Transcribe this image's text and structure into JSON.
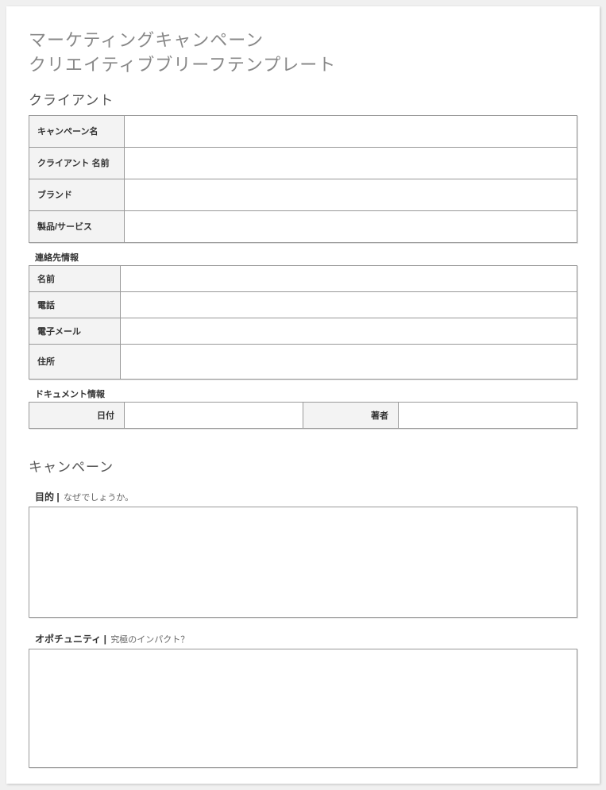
{
  "title1": "マーケティングキャンペーン",
  "title2": "クリエイティブブリーフテンプレート",
  "sections": {
    "client": {
      "heading": "クライアント",
      "rows": {
        "campaign_name": {
          "label": "キャンペーン名",
          "value": ""
        },
        "client_name": {
          "label": "クライアント 名前",
          "value": ""
        },
        "brand": {
          "label": "ブランド",
          "value": ""
        },
        "product_service": {
          "label": "製品/サービス",
          "value": ""
        }
      }
    },
    "contact": {
      "heading": "連絡先情報",
      "rows": {
        "name": {
          "label": "名前",
          "value": ""
        },
        "phone": {
          "label": "電話",
          "value": ""
        },
        "email": {
          "label": "電子メール",
          "value": ""
        },
        "address": {
          "label": "住所",
          "value": ""
        }
      }
    },
    "docinfo": {
      "heading": "ドキュメント情報",
      "date": {
        "label": "日付",
        "value": ""
      },
      "author": {
        "label": "著者",
        "value": ""
      }
    },
    "campaign": {
      "heading": "キャンペーン",
      "purpose": {
        "label": "目的",
        "hint": "なぜでしょうか。",
        "value": ""
      },
      "opportunity": {
        "label": "オポチュニティ",
        "hint": "究極のインパクト？",
        "value": ""
      }
    }
  }
}
